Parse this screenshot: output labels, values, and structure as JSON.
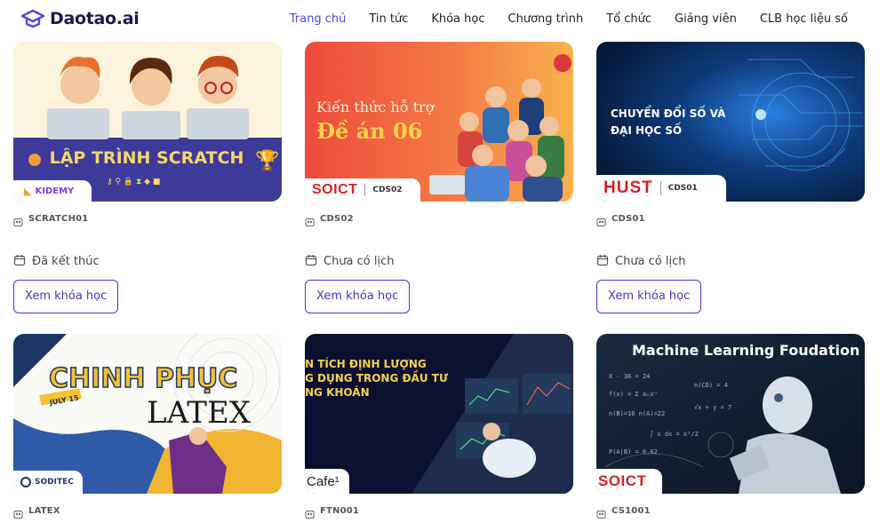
{
  "brand": {
    "name": "Daotao.ai"
  },
  "nav": [
    {
      "label": "Trang chủ",
      "active": true
    },
    {
      "label": "Tin tức"
    },
    {
      "label": "Khóa học"
    },
    {
      "label": "Chương trình"
    },
    {
      "label": "Tổ chức"
    },
    {
      "label": "Giảng viên"
    },
    {
      "label": "CLB học liệu số"
    }
  ],
  "courses": [
    {
      "code": "SCRATCH01",
      "status": "Đã kết thúc",
      "button": "Xem khóa học",
      "thumb": {
        "title": "LẬP TRÌNH SCRATCH",
        "badge": "KIDEMY"
      }
    },
    {
      "code": "CDS02",
      "status": "Chưa có lịch",
      "button": "Xem khóa học",
      "thumb": {
        "line1": "Kiến thức hỗ trợ",
        "line2": "Đề án 06",
        "badge": "SOICT",
        "badge_code": "CDS02"
      }
    },
    {
      "code": "CDS01",
      "status": "Chưa có lịch",
      "button": "Xem khóa học",
      "thumb": {
        "line1": "CHUYỂN ĐỔI SỐ VÀ",
        "line2": "ĐẠI HỌC SỐ",
        "badge": "HUST",
        "badge_code": "CDS01"
      }
    },
    {
      "code": "LATEX",
      "thumb": {
        "line1": "CHINH PHỤC",
        "line2": "LATEX",
        "ribbon": "JULY 15",
        "badge": "SODITEC"
      }
    },
    {
      "code": "FTN001",
      "thumb": {
        "line1": "N TÍCH ĐỊNH LƯỢNG",
        "line2": "G DỤNG TRONG ĐẦU TƯ",
        "line3": "NG KHOÁN",
        "badge": "Cafe¹"
      }
    },
    {
      "code": "CS1001",
      "thumb": {
        "title": "Machine Learning Foudation",
        "badge": "SOICT"
      }
    }
  ],
  "colors": {
    "accent": "#4f46e5",
    "button_border": "#4338ca"
  }
}
